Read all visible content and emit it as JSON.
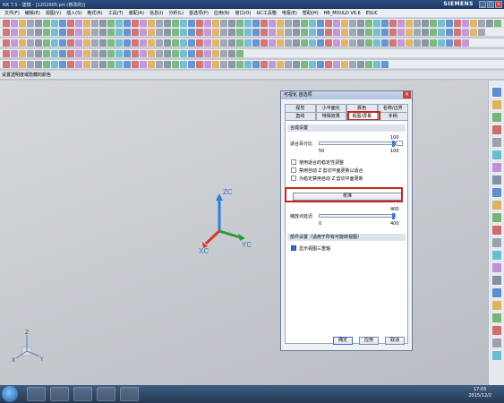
{
  "window": {
    "title": "NX 7.5 - 建模 - [1202005.prt (修改的)]",
    "brand": "SIEMENS"
  },
  "menu": [
    "文件(F)",
    "编辑(E)",
    "视图(V)",
    "插入(S)",
    "格式(R)",
    "工具(T)",
    "装配(A)",
    "信息(I)",
    "分析(L)",
    "首选项(P)",
    "应用(N)",
    "窗口(O)",
    "GC工具箱",
    "电极(E)",
    "帮助(H)",
    "HB_MOULD V6.6",
    "ESUC"
  ],
  "status": {
    "text": "设置透明度或隐藏的颜色"
  },
  "axes": {
    "zc": "ZC",
    "yc": "YC",
    "xc": "XC",
    "mini_z": "Z",
    "mini_x": "X",
    "mini_y": "Y"
  },
  "dialog": {
    "title": "可视化 首选项",
    "tabs_row1": [
      "视觉",
      "小平面化",
      "颜色",
      "名称/边界"
    ],
    "tabs_row2": [
      "直线",
      "特殊效果",
      "视图/屏幕",
      "手柄"
    ],
    "active_tab": "视图/屏幕",
    "section1": {
      "title": "合成设置",
      "slider1": {
        "label": "适合百分比",
        "min": "50",
        "max": "100",
        "value": "100",
        "value_fraction": 1.0
      },
      "checkboxes": [
        {
          "label": "使用适合的稳定性调整",
          "checked": false
        },
        {
          "label": "禁用自动 Z 剪切平面更新以适合",
          "checked": false
        },
        {
          "label": "为稳定禁用自动 Z 剪切平面更新",
          "checked": false
        }
      ],
      "button_label": "校准",
      "slider2": {
        "label": "缩放点延迟",
        "min": "0",
        "max": "400",
        "value": "400",
        "value_fraction": 1.0
      }
    },
    "section2": {
      "title": "部件设置（适用于所有可旋转视图）",
      "checkbox": {
        "label": "显示视图三重轴",
        "checked": true
      }
    },
    "footer": [
      "确定",
      "应用",
      "取消"
    ]
  },
  "clock": {
    "time": "17:05",
    "date": "2015/12/2"
  },
  "colors": {
    "highlight": "#d02020",
    "axis_z": "#2f7fd6",
    "axis_y": "#2a9b3c",
    "axis_x": "#d33a2c"
  }
}
